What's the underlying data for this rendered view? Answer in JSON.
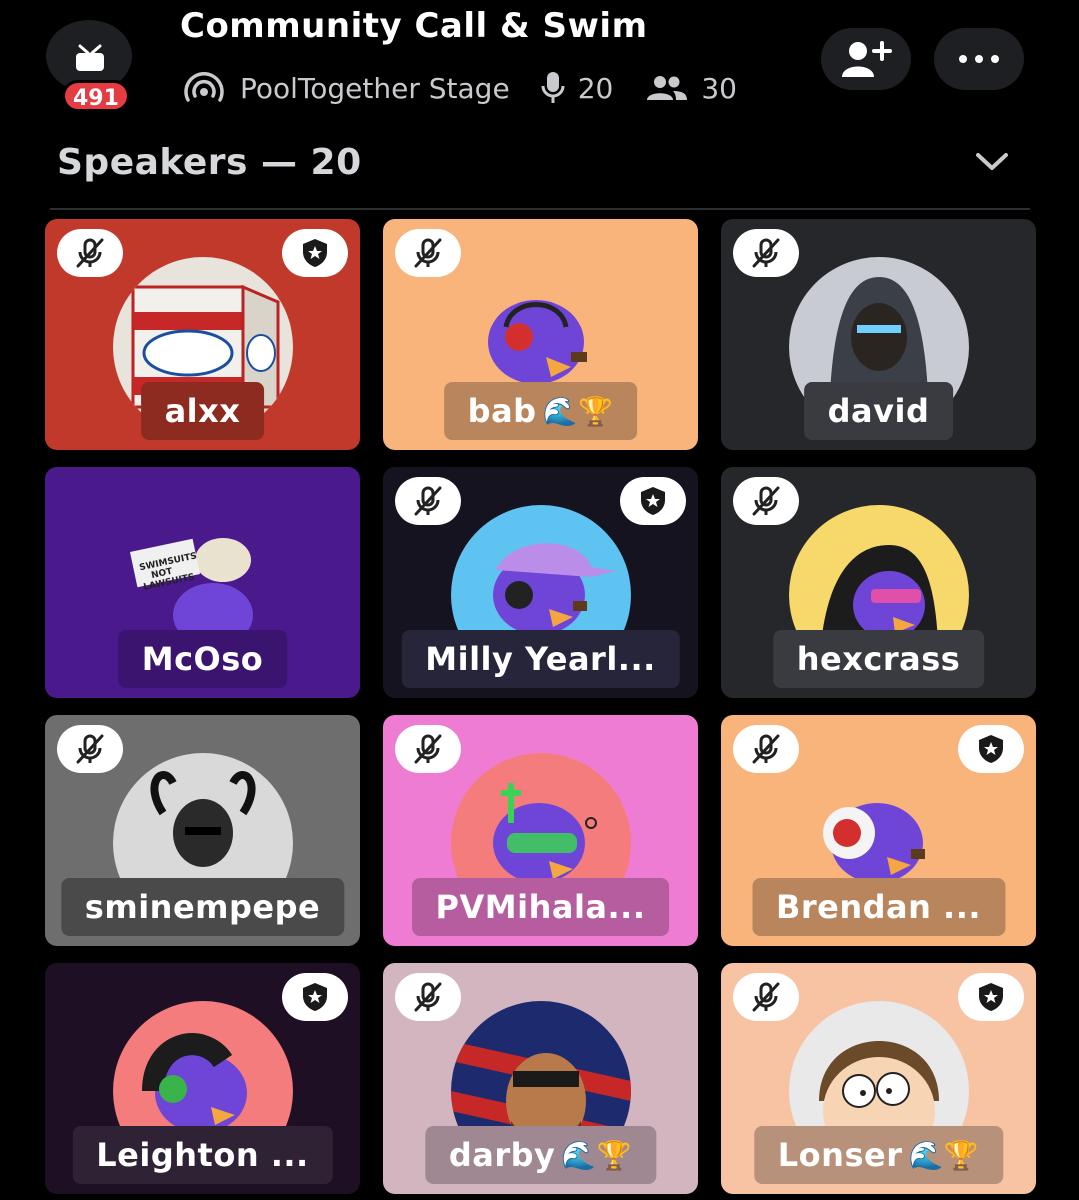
{
  "header": {
    "badge_count": "491",
    "title": "Community Call & Swim",
    "stage_name": "PoolTogether Stage",
    "speaker_count": "20",
    "listener_count": "30"
  },
  "section": {
    "label": "Speakers — 20"
  },
  "speakers": [
    {
      "name": "alxx",
      "suffix": "",
      "bg": "#c0392b",
      "pill": "#8e2b21",
      "muted": true,
      "moderator": true
    },
    {
      "name": "bab",
      "suffix": "🌊🏆",
      "bg": "#f9b47c",
      "pill": "#b9855c",
      "muted": true,
      "moderator": false
    },
    {
      "name": "david",
      "suffix": "",
      "bg": "#26272b",
      "pill": "#3a3b40",
      "muted": true,
      "moderator": false
    },
    {
      "name": "McOso",
      "suffix": "",
      "bg": "#4a1a8c",
      "pill": "#3b1470",
      "muted": false,
      "moderator": false
    },
    {
      "name": "Milly Yearl...",
      "suffix": "",
      "bg": "#15131f",
      "pill": "#27253a",
      "muted": true,
      "moderator": true
    },
    {
      "name": "hexcrass",
      "suffix": "",
      "bg": "#26272b",
      "pill": "#3a3b40",
      "muted": true,
      "moderator": false
    },
    {
      "name": "sminempepe",
      "suffix": "",
      "bg": "#6e6e6e",
      "pill": "#4a4a4a",
      "muted": true,
      "moderator": false
    },
    {
      "name": "PVMihala...",
      "suffix": "",
      "bg": "#ef7cd3",
      "pill": "#b55d9f",
      "muted": true,
      "moderator": false
    },
    {
      "name": "Brendan ...",
      "suffix": "",
      "bg": "#f9b47c",
      "pill": "#b9855c",
      "muted": true,
      "moderator": true
    },
    {
      "name": "Leighton ...",
      "suffix": "",
      "bg": "#1f0f24",
      "pill": "#2f2235",
      "muted": false,
      "moderator": true
    },
    {
      "name": "darby",
      "suffix": "🌊🏆",
      "bg": "#d3b5c0",
      "pill": "#9f8891",
      "muted": true,
      "moderator": false
    },
    {
      "name": "Lonser",
      "suffix": "🌊🏆",
      "bg": "#f7c3a3",
      "pill": "#b8917a",
      "muted": true,
      "moderator": true
    }
  ]
}
